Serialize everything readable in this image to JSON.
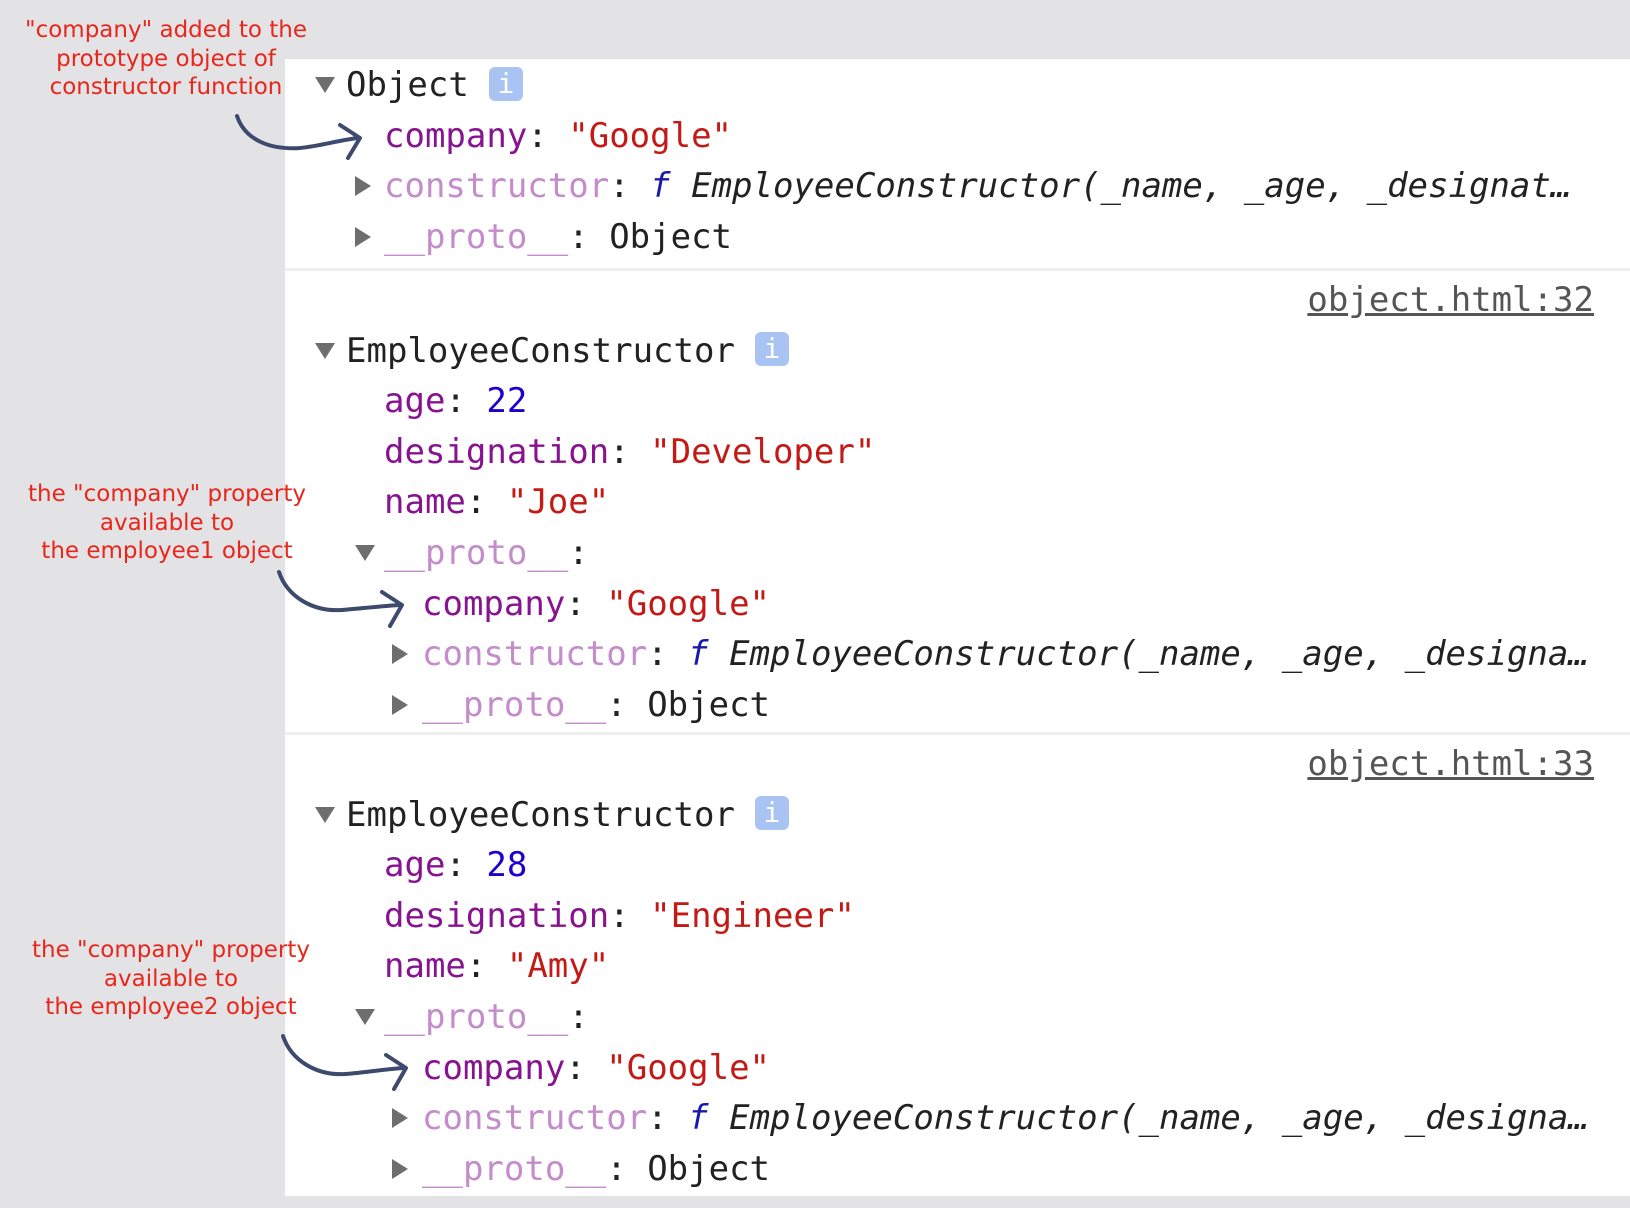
{
  "annotations": [
    [
      "\"company\" added to the",
      "prototype object of",
      "constructor function"
    ],
    [
      "the \"company\" property",
      "available to",
      "the employee1 object"
    ],
    [
      "the \"company\" property",
      "available to",
      "the employee2 object"
    ]
  ],
  "colors": {
    "key": "#881391",
    "string": "#c41a16",
    "number": "#1c00cf",
    "annotation": "#e8261b",
    "arrow": "#3d4a6e"
  },
  "object_log": {
    "title": "Object",
    "info_icon": "i",
    "company_key": "company",
    "company_value": "\"Google\"",
    "constructor_key": "constructor",
    "constructor_f": "f",
    "constructor_sig": "EmployeeConstructor(_name, _age, _designat…",
    "proto_key": "__proto__",
    "proto_value": "Object"
  },
  "employees": [
    {
      "source": "object.html:32",
      "title": "EmployeeConstructor",
      "info_icon": "i",
      "age": "22",
      "designation": "\"Developer\"",
      "name": "\"Joe\"",
      "proto_company": "\"Google\"",
      "constructor_sig": "EmployeeConstructor(_name, _age, _designa…",
      "proto_value": "Object"
    },
    {
      "source": "object.html:33",
      "title": "EmployeeConstructor",
      "info_icon": "i",
      "age": "28",
      "designation": "\"Engineer\"",
      "name": "\"Amy\"",
      "proto_company": "\"Google\"",
      "constructor_sig": "EmployeeConstructor(_name, _age, _designa…",
      "proto_value": "Object"
    }
  ],
  "labels": {
    "age": "age",
    "designation": "designation",
    "name": "name",
    "company": "company",
    "constructor": "constructor",
    "proto": "__proto__",
    "colon": ":",
    "f": "f"
  }
}
